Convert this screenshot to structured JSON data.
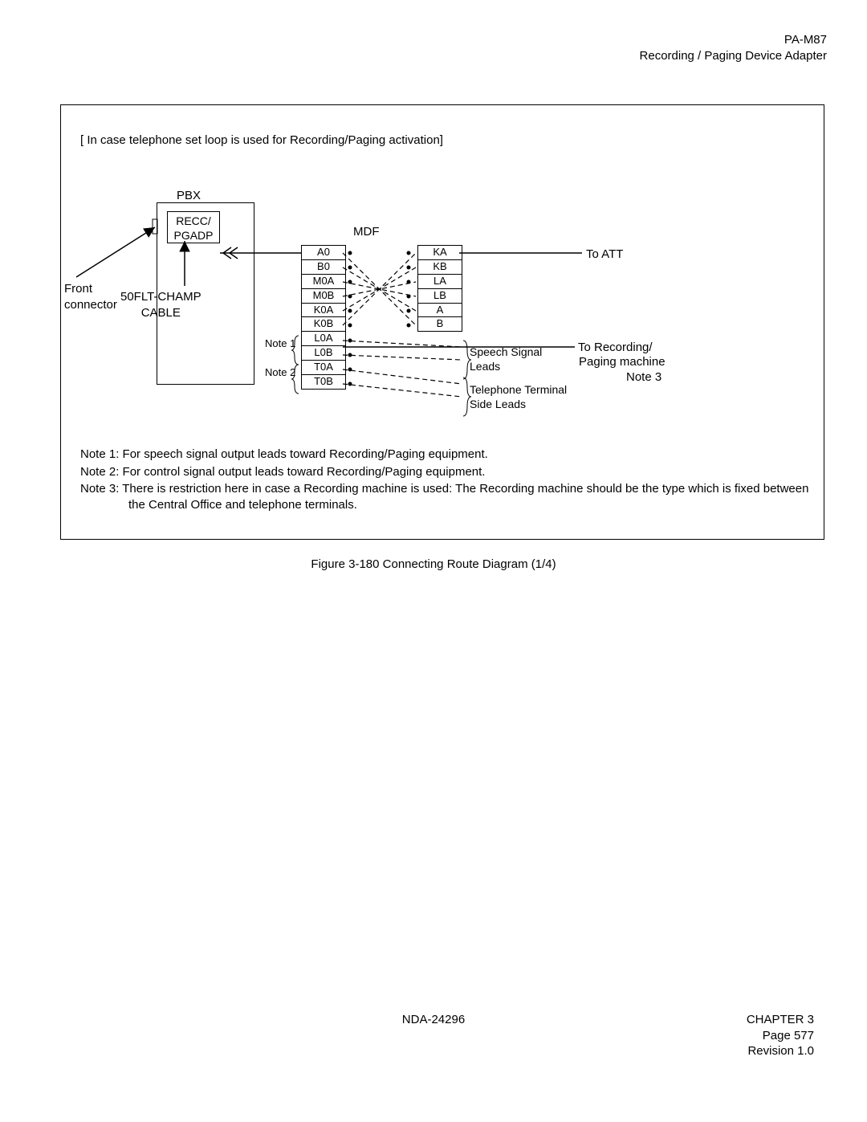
{
  "header": {
    "line1": "PA-M87",
    "line2": "Recording / Paging Device Adapter"
  },
  "intro": "[ In case telephone set loop is used for Recording/Paging activation]",
  "pbx_label": "PBX",
  "recc_line1": "RECC/",
  "recc_line2": "PGADP",
  "mdf_label": "MDF",
  "front_label_line1": "Front",
  "front_label_line2": "connector",
  "champ_line1": "50FLT-CHAMP",
  "champ_line2": "CABLE",
  "note1_label": "Note 1",
  "note2_label": "Note 2",
  "left_rows": [
    "A0",
    "B0",
    "M0A",
    "M0B",
    "K0A",
    "K0B",
    "L0A",
    "L0B",
    "T0A",
    "T0B"
  ],
  "right_rows": [
    "KA",
    "KB",
    "LA",
    "LB",
    "A",
    "B"
  ],
  "to_att": "To ATT",
  "to_rec_line1": "To Recording/",
  "to_rec_line2": "Paging machine",
  "to_rec_line3": "Note 3",
  "sig_line1": "Speech Signal",
  "sig_line2": "Leads",
  "sig_line3": "Telephone Terminal",
  "sig_line4": "Side Leads",
  "notes": {
    "n1": "Note 1:  For speech signal output leads toward Recording/Paging equipment.",
    "n2": "Note 2:  For control signal output leads toward Recording/Paging equipment.",
    "n3": "Note 3:  There is restriction here in case a Recording machine is used:   The Recording machine should be the type which is fixed between the Central Office and telephone terminals."
  },
  "fig_caption": "Figure 3-180   Connecting Route Diagram (1/4)",
  "footer": {
    "doc": "NDA-24296",
    "chapter": "CHAPTER 3",
    "page": "Page 577",
    "rev": "Revision 1.0"
  }
}
